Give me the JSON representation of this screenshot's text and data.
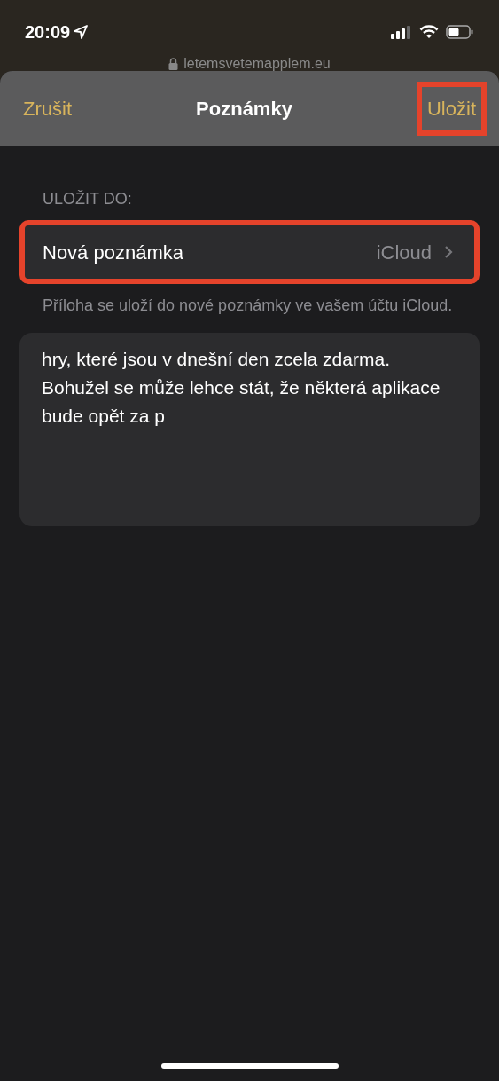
{
  "status_bar": {
    "time": "20:09"
  },
  "url_bar": {
    "address": "letemsvetemapplem.eu"
  },
  "header": {
    "cancel": "Zrušit",
    "title": "Poznámky",
    "save": {
      "label": "Uložit",
      "highlighted": true
    }
  },
  "section_label": "ULOŽIT DO:",
  "destination": {
    "label": "Nová poznámka",
    "value": "iCloud",
    "highlighted": true
  },
  "footnote": "Příloha se uloží do nové poznámky ve vašem účtu iCloud.",
  "note_text": "hry, které jsou v dnešní den zcela zdarma. Bohužel se může lehce stát, že některá aplikace bude opět za p"
}
